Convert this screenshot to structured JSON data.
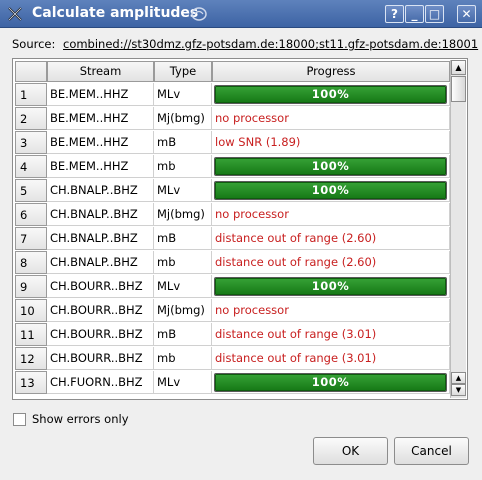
{
  "window": {
    "title": "Calculate amplitudes",
    "icon": "scissors-app-icon",
    "controls": {
      "help": "?",
      "minimize": "_",
      "maximize": "□",
      "close": "✕"
    }
  },
  "source": {
    "label": "Source:",
    "value": "combined://st30dmz.gfz-potsdam.de:18000;st11.gfz-potsdam.de:18001"
  },
  "table": {
    "headers": {
      "num": "",
      "stream": "Stream",
      "type": "Type",
      "progress": "Progress"
    },
    "rows": [
      {
        "num": "1",
        "stream": "BE.MEM..HHZ",
        "type": "MLv",
        "progress": "100%",
        "status": ""
      },
      {
        "num": "2",
        "stream": "BE.MEM..HHZ",
        "type": "Mj(bmg)",
        "progress": "",
        "status": "no processor"
      },
      {
        "num": "3",
        "stream": "BE.MEM..HHZ",
        "type": "mB",
        "progress": "",
        "status": "low SNR (1.89)"
      },
      {
        "num": "4",
        "stream": "BE.MEM..HHZ",
        "type": "mb",
        "progress": "100%",
        "status": ""
      },
      {
        "num": "5",
        "stream": "CH.BNALP..BHZ",
        "type": "MLv",
        "progress": "100%",
        "status": ""
      },
      {
        "num": "6",
        "stream": "CH.BNALP..BHZ",
        "type": "Mj(bmg)",
        "progress": "",
        "status": "no processor"
      },
      {
        "num": "7",
        "stream": "CH.BNALP..BHZ",
        "type": "mB",
        "progress": "",
        "status": "distance out of range (2.60)"
      },
      {
        "num": "8",
        "stream": "CH.BNALP..BHZ",
        "type": "mb",
        "progress": "",
        "status": "distance out of range (2.60)"
      },
      {
        "num": "9",
        "stream": "CH.BOURR..BHZ",
        "type": "MLv",
        "progress": "100%",
        "status": ""
      },
      {
        "num": "10",
        "stream": "CH.BOURR..BHZ",
        "type": "Mj(bmg)",
        "progress": "",
        "status": "no processor"
      },
      {
        "num": "11",
        "stream": "CH.BOURR..BHZ",
        "type": "mB",
        "progress": "",
        "status": "distance out of range (3.01)"
      },
      {
        "num": "12",
        "stream": "CH.BOURR..BHZ",
        "type": "mb",
        "progress": "",
        "status": "distance out of range (3.01)"
      },
      {
        "num": "13",
        "stream": "CH.FUORN..BHZ",
        "type": "MLv",
        "progress": "100%",
        "status": ""
      }
    ]
  },
  "options": {
    "show_errors_only": {
      "label": "Show errors only",
      "checked": false
    }
  },
  "buttons": {
    "ok": "OK",
    "cancel": "Cancel"
  },
  "colors": {
    "titlebar": "#4a6fae",
    "progress_fill": "#1f8a1f",
    "status_text": "#c82020"
  }
}
